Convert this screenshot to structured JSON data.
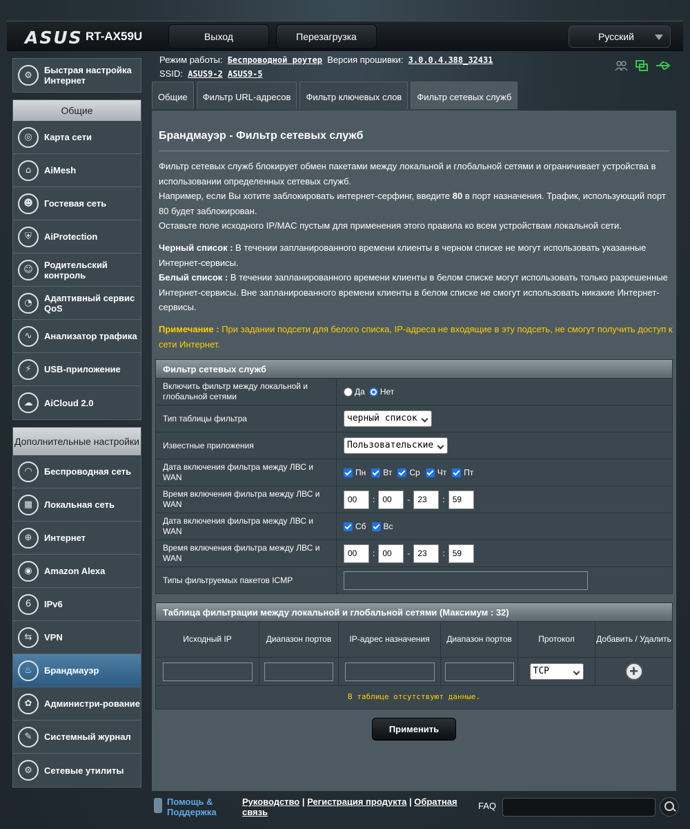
{
  "header": {
    "brand": "ASUS",
    "model": "RT-AX59U",
    "logout": "Выход",
    "reboot": "Перезагрузка",
    "language": "Русский"
  },
  "info": {
    "mode_label": "Режим работы:",
    "mode_value": "Беспроводной роутер",
    "fw_label": "Версия прошивки:",
    "fw_value": "3.0.0.4.388_32431",
    "ssid_label": "SSID:",
    "ssid1": "ASUS9-2",
    "ssid2": "ASUS9-5"
  },
  "sidebar": {
    "quick": "Быстрая настройка Интернет",
    "general_header": "Общие",
    "general": [
      {
        "label": "Карта сети",
        "icon": "network-map-icon"
      },
      {
        "label": "AiMesh",
        "icon": "aimesh-icon"
      },
      {
        "label": "Гостевая сеть",
        "icon": "guest-network-icon"
      },
      {
        "label": "AiProtection",
        "icon": "shield-lock-icon"
      },
      {
        "label": "Родительский контроль",
        "icon": "parental-control-icon"
      },
      {
        "label": "Адаптивный сервис QoS",
        "icon": "speedometer-icon"
      },
      {
        "label": "Анализатор трафика",
        "icon": "traffic-analyzer-icon"
      },
      {
        "label": "USB-приложение",
        "icon": "usb-icon"
      },
      {
        "label": "AiCloud 2.0",
        "icon": "cloud-icon"
      }
    ],
    "advanced_header": "Дополнительные настройки",
    "advanced": [
      {
        "label": "Беспроводная сеть",
        "icon": "wireless-icon"
      },
      {
        "label": "Локальная сеть",
        "icon": "lan-icon"
      },
      {
        "label": "Интернет",
        "icon": "globe-icon"
      },
      {
        "label": "Amazon Alexa",
        "icon": "alexa-icon"
      },
      {
        "label": "IPv6",
        "icon": "ipv6-icon"
      },
      {
        "label": "VPN",
        "icon": "vpn-icon"
      },
      {
        "label": "Брандмауэр",
        "icon": "firewall-icon"
      },
      {
        "label": "Администри-рование",
        "icon": "admin-icon"
      },
      {
        "label": "Системный журнал",
        "icon": "syslog-icon"
      },
      {
        "label": "Сетевые утилиты",
        "icon": "gear-icon"
      }
    ]
  },
  "tabs": [
    "Общие",
    "Фильтр URL-адресов",
    "Фильтр ключевых слов",
    "Фильтр сетевых служб"
  ],
  "page": {
    "title": "Брандмауэр - Фильтр сетевых служб",
    "p1": "Фильтр сетевых служб блокирует обмен пакетами между локальной и глобальной сетями и ограничивает устройства в использовании определенных сетевых служб.",
    "p2_a": "Например, если Вы хотите заблокировать интернет-серфинг, введите ",
    "p2_b": "80",
    "p2_c": " в порт назначения. Трафик, использующий порт 80 будет заблокирован.",
    "p3": "Оставьте поле исходного IP/MAC пустым для применения этого правила ко всем устройствам локальной сети.",
    "bl_label": "Черный список :",
    "bl_text": " В течении запланированного времени клиенты в черном списке не могут использовать указанные Интернет-сервисы.",
    "wl_label": "Белый список :",
    "wl_text": " В течении запланированного времени клиенты в белом списке могут использовать только разрешенные Интернет-сервисы. Вне запланированного времени клиенты в белом списке не смогут использовать никакие Интернет-сервисы.",
    "note_label": "Примечание :",
    "note_text": " При задании подсети для белого списка, IP-адреса не входящие в эту подсеть, не смогут получить доступ к сети Интернет."
  },
  "filter": {
    "header": "Фильтр сетевых служб",
    "enable_label": "Включить фильтр между локальной и глобальной сетями",
    "yes": "Да",
    "no": "Нет",
    "table_type_label": "Тип таблицы фильтра",
    "table_type_value": "черный список",
    "apps_label": "Известные приложения",
    "apps_value": "Пользовательские",
    "date1_label": "Дата включения фильтра между ЛВС и WAN",
    "days1": [
      "Пн",
      "Вт",
      "Ср",
      "Чт",
      "Пт"
    ],
    "time1_label": "Время включения фильтра между ЛВС и WAN",
    "time1": [
      "00",
      "00",
      "23",
      "59"
    ],
    "date2_label": "Дата включения фильтра между ЛВС и WAN",
    "days2": [
      "Сб",
      "Вс"
    ],
    "time2_label": "Время включения фильтра между ЛВС и WAN",
    "time2": [
      "00",
      "00",
      "23",
      "59"
    ],
    "icmp_label": "Типы фильтруемых пакетов ICMP"
  },
  "rules": {
    "header": "Таблица фильтрации между локальной и глобальной сетями (Максимум : 32)",
    "cols": [
      "Исходный IP",
      "Диапазон портов",
      "IP-адрес назначения",
      "Диапазон портов",
      "Протокол",
      "Добавить / Удалить"
    ],
    "protocol": "TCP",
    "empty": "В таблице отсутствуют данные."
  },
  "apply": "Применить",
  "footer": {
    "help": "Помощь & Поддержка",
    "manual": "Руководство",
    "register": "Регистрация продукта",
    "feedback": "Обратная связь",
    "sep": " | ",
    "faq": "FAQ"
  },
  "colors": {
    "note": "#ffcc00",
    "active_nav": "#3b6a92",
    "help_link": "#5fa8e6"
  }
}
